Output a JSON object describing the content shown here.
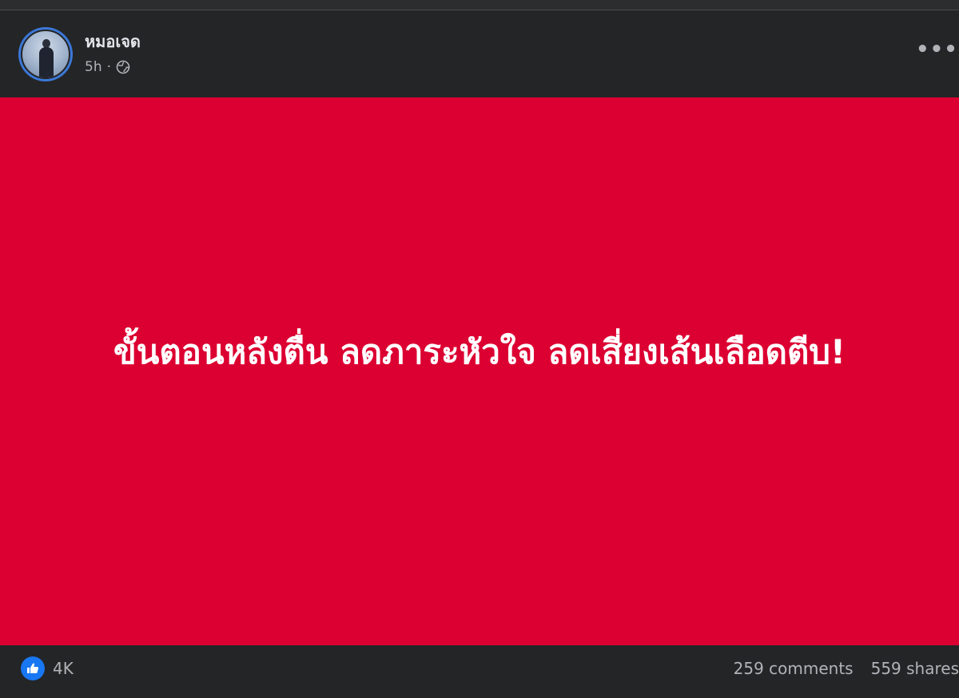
{
  "post": {
    "author": "หมอเจด",
    "time": "5h",
    "separator": "·",
    "privacy_icon": "globe-icon",
    "more_label": "•••"
  },
  "image": {
    "background_color": "#dc0032",
    "headline": "ขั้นตอนหลังตื่น ลดภาระหัวใจ ลดเสี่ยงเส้นเลือดตีบ!"
  },
  "footer": {
    "reaction_icon": "like-icon",
    "reaction_count": "4K",
    "comments": "259 comments",
    "shares": "559 shares"
  },
  "colors": {
    "background": "#242526",
    "text_primary": "#e4e6eb",
    "text_secondary": "#b0b3b8",
    "accent_blue": "#1877f2"
  }
}
